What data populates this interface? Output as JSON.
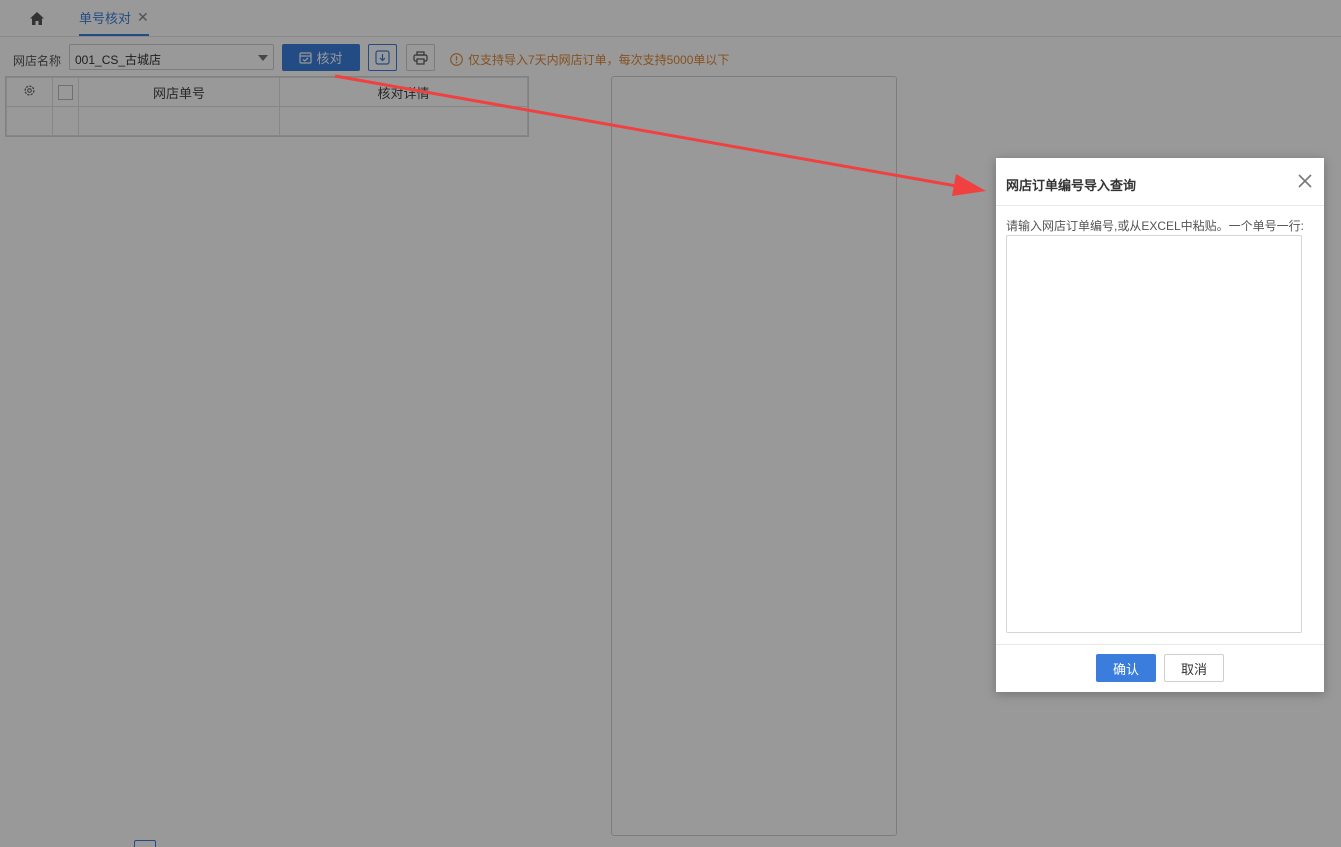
{
  "tabs": {
    "home_icon": "home-icon",
    "active_label": "单号核对",
    "close_icon": "close-icon"
  },
  "toolbar": {
    "shop_label": "网店名称",
    "shop_value": "001_CS_古城店",
    "check_label": "核对",
    "check_icon": "calendar-check-icon",
    "download_icon": "download-icon",
    "print_icon": "print-icon",
    "notice_icon": "info-circle-icon",
    "notice": "仅支持导入7天内网店订单，每次支持5000单以下"
  },
  "grid": {
    "settings_icon": "gear-icon",
    "columns": [
      "网店单号",
      "核对详情"
    ]
  },
  "dialog": {
    "title": "网店订单编号导入查询",
    "hint": "请输入网店订单编号,或从EXCEL中粘贴。一个单号一行:",
    "textarea_value": "",
    "ok_label": "确认",
    "cancel_label": "取消"
  },
  "colors": {
    "primary": "#3b7ddd",
    "notice": "#e0873a",
    "annotation_arrow": "#f04040"
  }
}
